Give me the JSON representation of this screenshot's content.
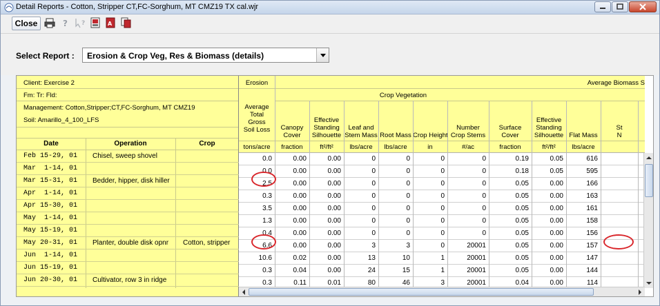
{
  "window": {
    "title": "Detail Reports - Cotton, Stripper CT,FC-Sorghum, MT CMZ19 TX cal.wjr"
  },
  "toolbar": {
    "close_label": "Close",
    "icons": [
      "print-icon",
      "help-icon",
      "context-help-icon",
      "export-icon",
      "pdf-icon",
      "copy-icon"
    ]
  },
  "select_report": {
    "label": "Select Report :",
    "value": "Erosion & Crop Veg, Res & Biomass (details)"
  },
  "left_header": {
    "client": "Client: Exercise 2",
    "fm": "Fm:  Tr:  Fld:",
    "management": "Management: Cotton,Stripper;CT,FC-Sorghum, MT CMZ19",
    "soil": "Soil: Amarillo_4_100_LFS",
    "col_date": "Date",
    "col_operation": "Operation",
    "col_crop": "Crop"
  },
  "grid_header": {
    "erosion": "Erosion",
    "avg_biomass": "Average Biomass S",
    "crop_vegetation": "Crop Vegetation",
    "columns": [
      {
        "name": "Average\nTotal\nGross\nSoil Loss",
        "unit": "tons/acre"
      },
      {
        "name": "Canopy\nCover",
        "unit": "fraction"
      },
      {
        "name": "Effective\nStanding\nSilhouette",
        "unit": "ft²/ft²"
      },
      {
        "name": "Leaf and\nStem Mass",
        "unit": "lbs/acre"
      },
      {
        "name": "Root Mass",
        "unit": "lbs/acre"
      },
      {
        "name": "Crop Height",
        "unit": "in"
      },
      {
        "name": "Number\nCrop Stems",
        "unit": "#/ac"
      },
      {
        "name": "Surface\nCover",
        "unit": "fraction"
      },
      {
        "name": "Effective\nStanding\nSilhouette",
        "unit": "ft²/ft²"
      },
      {
        "name": "Flat Mass",
        "unit": "lbs/acre"
      },
      {
        "name": "St\nN",
        "unit": ""
      }
    ]
  },
  "rows": [
    {
      "date": "Feb 15-29, 01",
      "operation": "Chisel, sweep shovel",
      "crop": "",
      "values": [
        "0.0",
        "0.00",
        "0.00",
        "0",
        "0",
        "0",
        "0",
        "0.19",
        "0.05",
        "616"
      ]
    },
    {
      "date": "Mar  1-14, 01",
      "operation": "",
      "crop": "",
      "values": [
        "0.0",
        "0.00",
        "0.00",
        "0",
        "0",
        "0",
        "0",
        "0.18",
        "0.05",
        "595"
      ]
    },
    {
      "date": "Mar 15-31, 01",
      "operation": "Bedder, hipper, disk hiller",
      "crop": "",
      "values": [
        "2.5",
        "0.00",
        "0.00",
        "0",
        "0",
        "0",
        "0",
        "0.05",
        "0.00",
        "166"
      ]
    },
    {
      "date": "Apr  1-14, 01",
      "operation": "",
      "crop": "",
      "values": [
        "0.3",
        "0.00",
        "0.00",
        "0",
        "0",
        "0",
        "0",
        "0.05",
        "0.00",
        "163"
      ]
    },
    {
      "date": "Apr 15-30, 01",
      "operation": "",
      "crop": "",
      "values": [
        "3.5",
        "0.00",
        "0.00",
        "0",
        "0",
        "0",
        "0",
        "0.05",
        "0.00",
        "161"
      ]
    },
    {
      "date": "May  1-14, 01",
      "operation": "",
      "crop": "",
      "values": [
        "1.3",
        "0.00",
        "0.00",
        "0",
        "0",
        "0",
        "0",
        "0.05",
        "0.00",
        "158"
      ]
    },
    {
      "date": "May 15-19, 01",
      "operation": "",
      "crop": "",
      "values": [
        "0.4",
        "0.00",
        "0.00",
        "0",
        "0",
        "0",
        "0",
        "0.05",
        "0.00",
        "156"
      ]
    },
    {
      "date": "May 20-31, 01",
      "operation": "Planter, double disk opnr",
      "crop": "Cotton, stripper",
      "values": [
        "6.6",
        "0.00",
        "0.00",
        "3",
        "3",
        "0",
        "20001",
        "0.05",
        "0.00",
        "157"
      ]
    },
    {
      "date": "Jun  1-14, 01",
      "operation": "",
      "crop": "",
      "values": [
        "10.6",
        "0.02",
        "0.00",
        "13",
        "10",
        "1",
        "20001",
        "0.05",
        "0.00",
        "147"
      ]
    },
    {
      "date": "Jun 15-19, 01",
      "operation": "",
      "crop": "",
      "values": [
        "0.3",
        "0.04",
        "0.00",
        "24",
        "15",
        "1",
        "20001",
        "0.05",
        "0.00",
        "144"
      ]
    },
    {
      "date": "Jun 20-30, 01",
      "operation": "Cultivator, row 3 in ridge",
      "crop": "",
      "values": [
        "0.3",
        "0.11",
        "0.01",
        "80",
        "46",
        "3",
        "20001",
        "0.04",
        "0.00",
        "114"
      ]
    }
  ],
  "colors": {
    "yellow_panel": "#ffff99",
    "annotation_red": "#d9262b"
  }
}
